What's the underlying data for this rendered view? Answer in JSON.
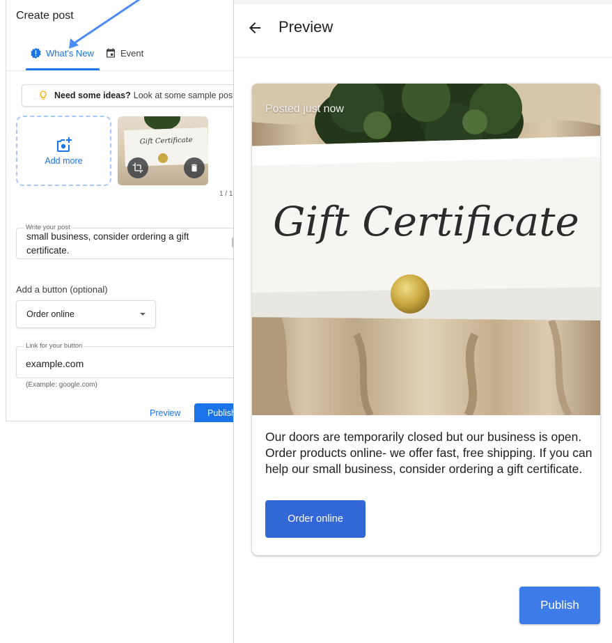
{
  "create_post": {
    "title": "Create post",
    "tabs": [
      {
        "label": "What's New",
        "active": true
      },
      {
        "label": "Event",
        "active": false
      }
    ],
    "ideas": {
      "bold": "Need some ideas?",
      "text": "Look at some sample posts."
    },
    "add_more_label": "Add more",
    "photo_counter": "1 / 1",
    "post_field": {
      "label": "Write your post",
      "value": "small business, consider ordering a gift certificate."
    },
    "button_section_label": "Add a button (optional)",
    "button_select": {
      "selected": "Order online"
    },
    "link_field": {
      "label": "Link for your button",
      "value": "example.com",
      "hint": "(Example: google.com)"
    },
    "preview_label": "Preview",
    "publish_label": "Publish"
  },
  "thumbnail": {
    "card_text": "Gift Certificate"
  },
  "preview": {
    "title": "Preview",
    "posted_label": "Posted just now",
    "image_text": "Gift Certificate",
    "description": "Our doors are temporarily closed but our business is open. Order products online- we offer fast, free shipping. If you can help our small business, consider ordering a gift certificate.",
    "cta_label": "Order online",
    "publish_label": "Publish"
  },
  "colors": {
    "accent": "#1a73e8",
    "annotation_arrow": "#4c8bf5",
    "idea_bulb": "#f9ab00"
  },
  "icons": [
    "info-badge-icon",
    "calendar-icon",
    "lightbulb-icon",
    "add-photo-icon",
    "crop-icon",
    "delete-icon",
    "dropdown-caret-icon",
    "back-arrow-icon"
  ]
}
